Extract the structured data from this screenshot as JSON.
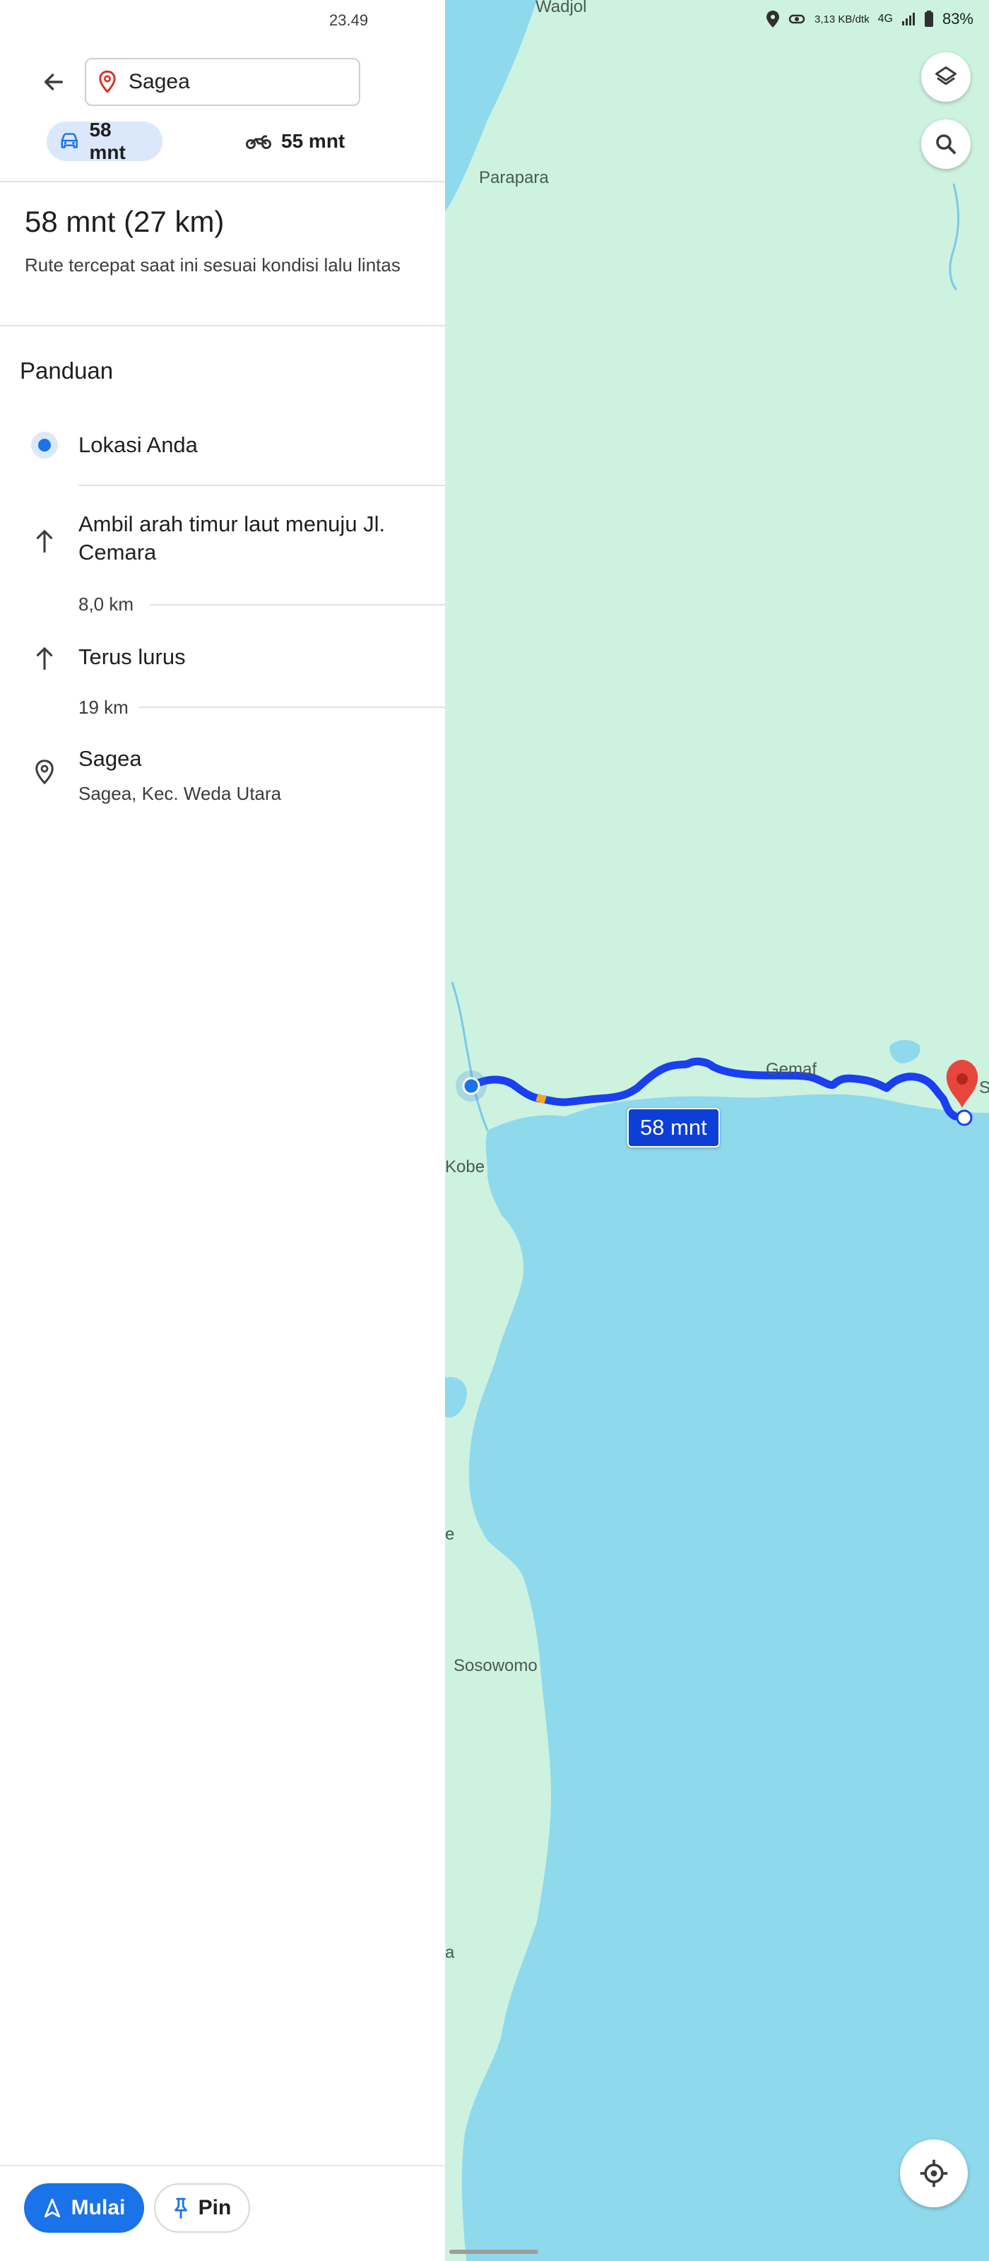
{
  "status_bar": {
    "time": "23.49",
    "network_speed": "3,13 KB/dtk",
    "network_type": "4G",
    "battery": "83%"
  },
  "search": {
    "destination": "Sagea"
  },
  "travel_modes": [
    {
      "mode": "car",
      "label": "58 mnt",
      "selected": true
    },
    {
      "mode": "motorcycle",
      "label": "55 mnt",
      "selected": false
    }
  ],
  "route_summary": {
    "title": "58 mnt (27 km)",
    "subtitle": "Rute tercepat saat ini sesuai kondisi lalu lintas"
  },
  "directions": {
    "section_title": "Panduan",
    "origin": "Lokasi Anda",
    "steps": [
      {
        "icon": "arrow-up-icon",
        "text": "Ambil arah timur laut menuju Jl. Cemara",
        "distance": "8,0 km"
      },
      {
        "icon": "arrow-up-icon",
        "text": "Terus lurus",
        "distance": "19 km"
      }
    ],
    "destination": {
      "name": "Sagea",
      "address": "Sagea, Kec. Weda Utara"
    }
  },
  "map": {
    "labels": {
      "wadjol": "Wadjol",
      "parapara": "Parapara",
      "gemaf": "Gemaf",
      "kobe": "Kobe",
      "sosowomo": "Sosowomo",
      "edge_s": "S",
      "edge_e": "e",
      "edge_a": "a"
    },
    "route_badge": "58 mnt",
    "colors": {
      "land": "#cdf2e0",
      "water": "#8fd9ec",
      "route": "#1a3ff0",
      "destination_pin": "#e8453c"
    }
  },
  "actions": {
    "start_label": "Mulai",
    "pin_label": "Pin"
  }
}
